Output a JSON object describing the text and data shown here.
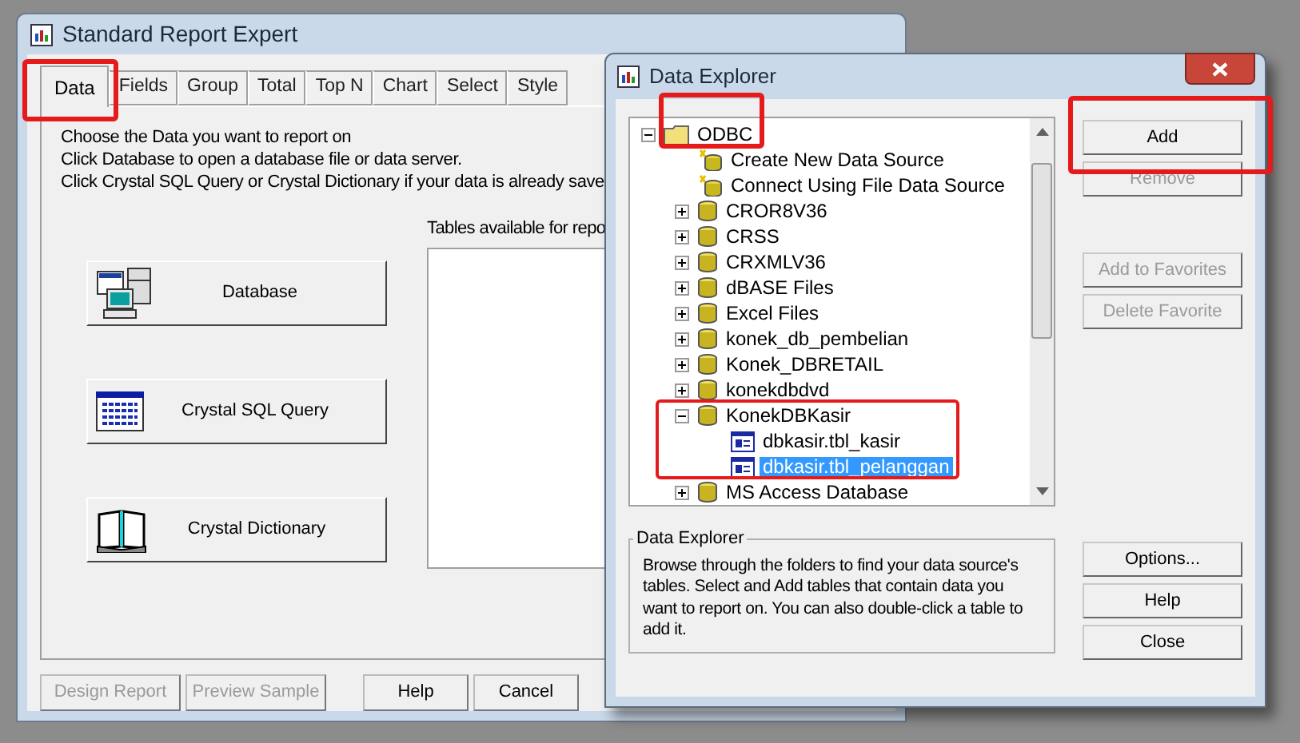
{
  "report_window": {
    "title": "Standard Report Expert",
    "tabs": [
      {
        "label": "Data",
        "selected": true
      },
      {
        "label": "Fields",
        "selected": false
      },
      {
        "label": "Group",
        "selected": false
      },
      {
        "label": "Total",
        "selected": false
      },
      {
        "label": "Top N",
        "selected": false
      },
      {
        "label": "Chart",
        "selected": false
      },
      {
        "label": "Select",
        "selected": false
      },
      {
        "label": "Style",
        "selected": false
      }
    ],
    "instructions": [
      "Choose the Data you want to report on",
      "Click Database to open a database file or data server.",
      "Click Crystal SQL Query or Crystal Dictionary if your data is already save"
    ],
    "source_buttons": [
      {
        "kind": "database",
        "label": "Database"
      },
      {
        "kind": "query",
        "label": "Crystal SQL Query"
      },
      {
        "kind": "dictionary",
        "label": "Crystal Dictionary"
      }
    ],
    "tables_label": "Tables available for repo",
    "footer_buttons": [
      {
        "label": "Design Report",
        "disabled": true
      },
      {
        "label": "Preview Sample",
        "disabled": true
      },
      {
        "label": "Help",
        "disabled": false
      },
      {
        "label": "Cancel",
        "disabled": false
      }
    ]
  },
  "explorer_window": {
    "title": "Data Explorer",
    "tree": [
      {
        "kind": "folder",
        "label": "ODBC",
        "expanded": true,
        "selected": false,
        "children": [
          {
            "kind": "new",
            "label": "Create New Data Source",
            "selected": false
          },
          {
            "kind": "new",
            "label": "Connect Using File Data Source",
            "selected": false
          },
          {
            "kind": "db",
            "label": "CROR8V36",
            "expanded": false,
            "selected": false
          },
          {
            "kind": "db",
            "label": "CRSS",
            "expanded": false,
            "selected": false
          },
          {
            "kind": "db",
            "label": "CRXMLV36",
            "expanded": false,
            "selected": false
          },
          {
            "kind": "db",
            "label": "dBASE Files",
            "expanded": false,
            "selected": false
          },
          {
            "kind": "db",
            "label": "Excel Files",
            "expanded": false,
            "selected": false
          },
          {
            "kind": "db",
            "label": "konek_db_pembelian",
            "expanded": false,
            "selected": false
          },
          {
            "kind": "db",
            "label": "Konek_DBRETAIL",
            "expanded": false,
            "selected": false
          },
          {
            "kind": "db",
            "label": "konekdbdvd",
            "expanded": false,
            "selected": false
          },
          {
            "kind": "db",
            "label": "KonekDBKasir",
            "expanded": true,
            "selected": false,
            "children": [
              {
                "kind": "table",
                "label": "dbkasir.tbl_kasir",
                "selected": false
              },
              {
                "kind": "table",
                "label": "dbkasir.tbl_pelanggan",
                "selected": true
              }
            ]
          },
          {
            "kind": "db",
            "label": "MS Access Database",
            "expanded": false,
            "selected": false
          }
        ]
      }
    ],
    "info_title": "Data Explorer",
    "info_text": "Browse through the folders to find your data source's tables.  Select and Add tables that contain data you want to report on.  You can also double-click a table to add it.",
    "top_buttons": [
      {
        "label": "Add",
        "disabled": false
      },
      {
        "label": "Remove",
        "disabled": true
      }
    ],
    "favorite_buttons": [
      {
        "label": "Add to Favorites",
        "disabled": true
      },
      {
        "label": "Delete Favorite",
        "disabled": true
      }
    ],
    "bottom_buttons": [
      {
        "label": "Options...",
        "disabled": false
      },
      {
        "label": "Help",
        "disabled": false
      },
      {
        "label": "Close",
        "disabled": false
      }
    ]
  }
}
